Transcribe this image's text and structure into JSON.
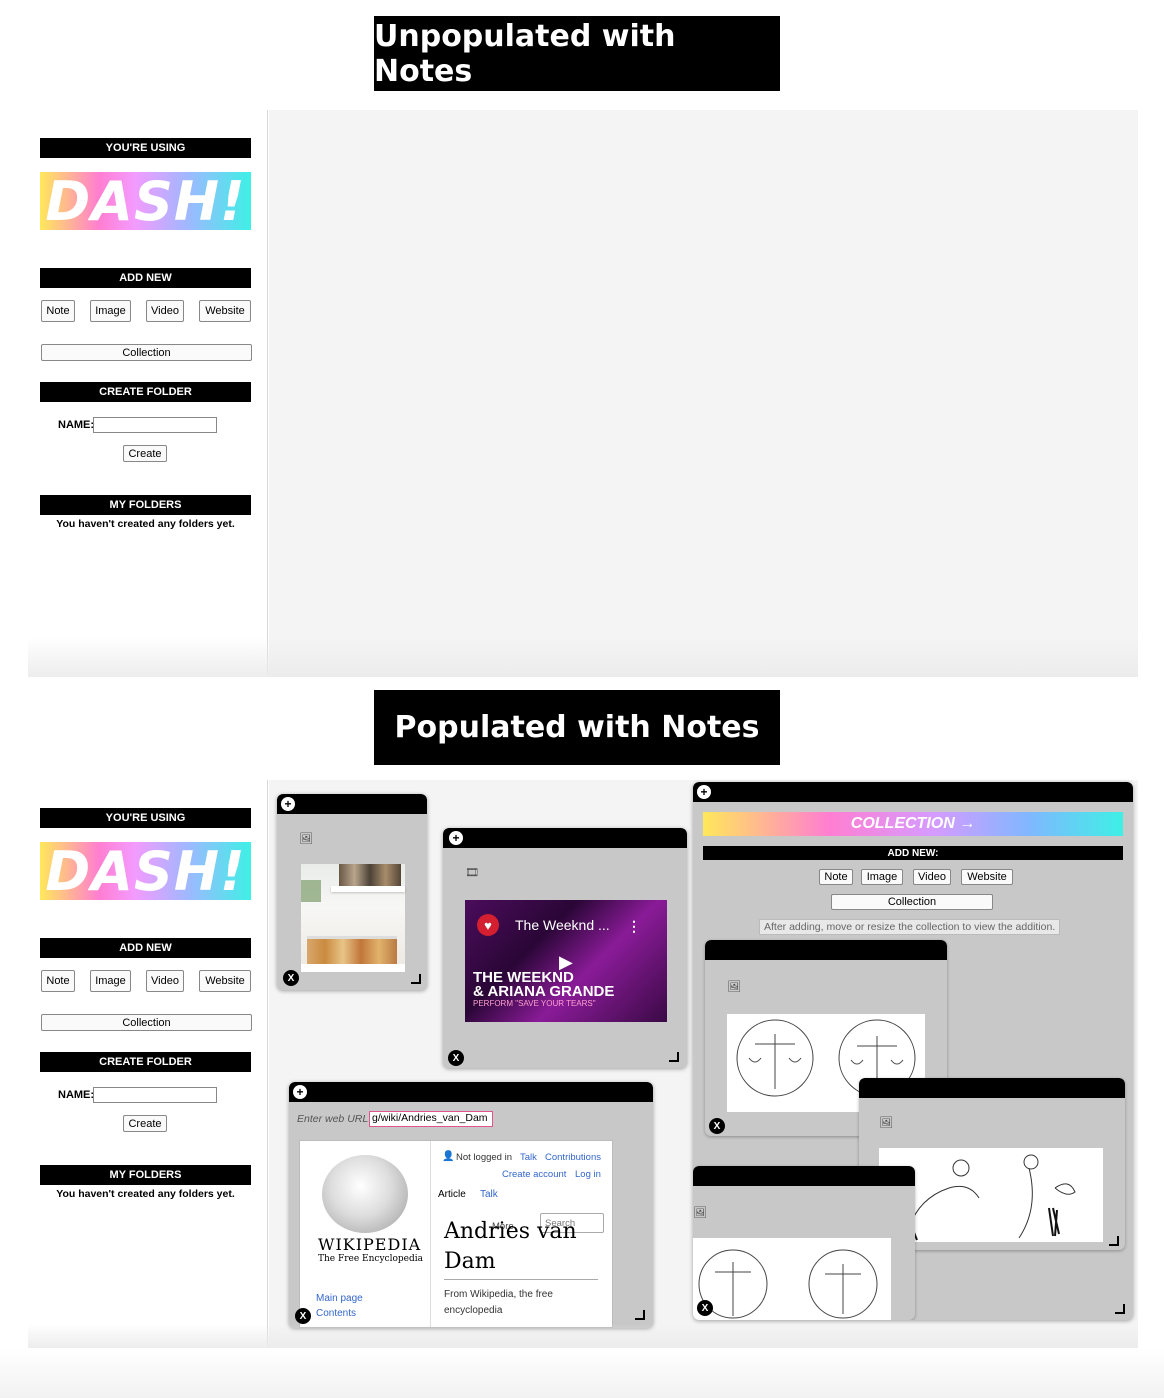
{
  "banners": {
    "top": "Unpopulated with Notes",
    "bottom": "Populated with Notes"
  },
  "sidebar": {
    "using_label": "YOU'RE USING",
    "logo_text": "DASH!",
    "add_new_label": "ADD NEW",
    "buttons": [
      "Note",
      "Image",
      "Video",
      "Website"
    ],
    "collection_label": "Collection",
    "create_folder_label": "CREATE FOLDER",
    "name_label": "NAME:",
    "name_value": "",
    "create_label": "Create",
    "my_folders_label": "MY FOLDERS",
    "no_folders_text": "You haven't created any folders yet."
  },
  "notes": {
    "plus": "+",
    "close": "X",
    "video": {
      "title": "The Weeknd ...",
      "line1": "THE WEEKND",
      "line2": "& ARIANA GRANDE",
      "line3": "PERFORM \"SAVE YOUR TEARS\""
    },
    "website": {
      "url_label": "Enter web URL",
      "url_value": "g/wiki/Andries_van_Dam",
      "not_logged": "Not logged in",
      "talk": "Talk",
      "contributions": "Contributions",
      "create_account": "Create account",
      "log_in": "Log in",
      "tab_article": "Article",
      "tab_talk": "Talk",
      "more": "More",
      "search": "Search",
      "wordmark": "WIKIPEDIA",
      "tagline": "The Free Encyclopedia",
      "heading_line1": "Andries van",
      "heading_line2": "Dam",
      "from": "From Wikipedia, the free",
      "from2": "encyclopedia",
      "nav_main": "Main page",
      "nav_contents": "Contents"
    },
    "collection": {
      "title": "COLLECTION →",
      "add_new": "ADD NEW:",
      "buttons": [
        "Note",
        "Image",
        "Video",
        "Website"
      ],
      "collection_btn": "Collection",
      "hint": "After adding, move or resize the collection to view the addition."
    }
  }
}
